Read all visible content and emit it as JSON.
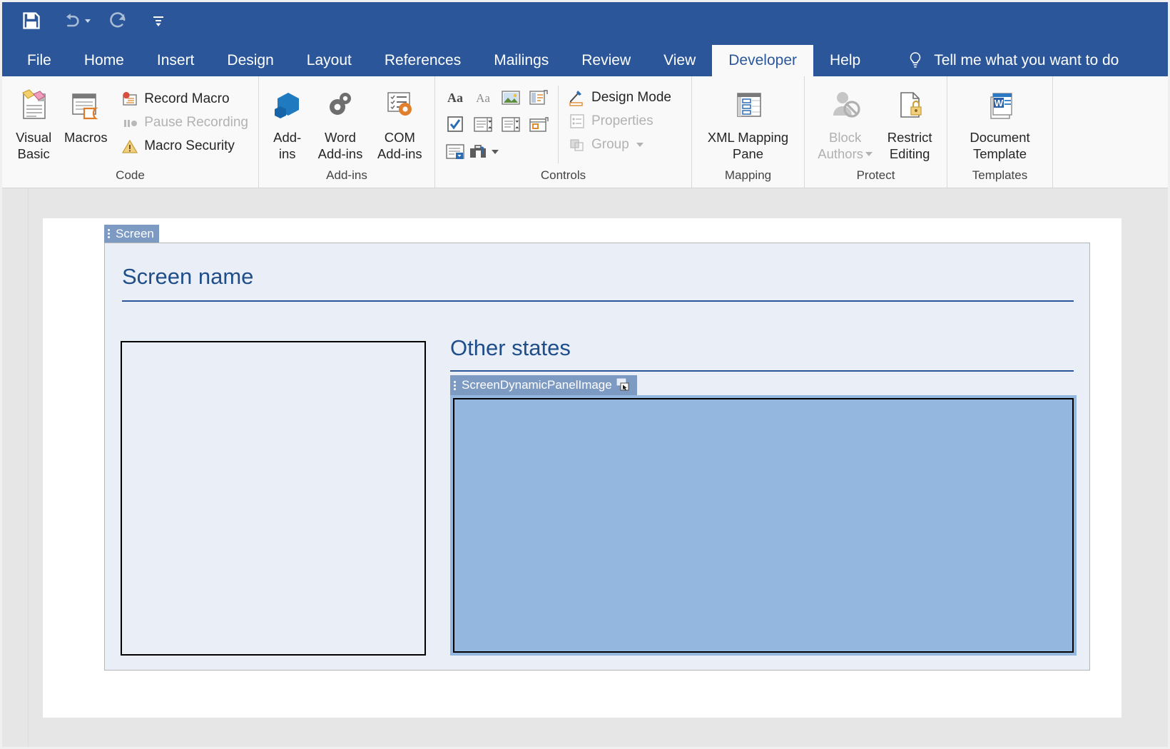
{
  "quick_access": {
    "items": [
      {
        "name": "save",
        "icon": "save-icon",
        "label": "Save",
        "enabled": true
      },
      {
        "name": "undo",
        "icon": "undo-icon",
        "label": "Undo",
        "enabled": false,
        "has_dropdown": true
      },
      {
        "name": "redo",
        "icon": "redo-icon",
        "label": "Redo",
        "enabled": false
      },
      {
        "name": "customize",
        "icon": "customize-quick-access-icon",
        "label": "Customize Quick Access Toolbar",
        "enabled": true
      }
    ]
  },
  "tabs": [
    {
      "label": "File",
      "active": false
    },
    {
      "label": "Home",
      "active": false
    },
    {
      "label": "Insert",
      "active": false
    },
    {
      "label": "Design",
      "active": false
    },
    {
      "label": "Layout",
      "active": false
    },
    {
      "label": "References",
      "active": false
    },
    {
      "label": "Mailings",
      "active": false
    },
    {
      "label": "Review",
      "active": false
    },
    {
      "label": "View",
      "active": false
    },
    {
      "label": "Developer",
      "active": true
    },
    {
      "label": "Help",
      "active": false
    }
  ],
  "tell_me": {
    "label": "Tell me what you want to do",
    "icon": "lightbulb-icon"
  },
  "ribbon": {
    "groups": [
      {
        "label": "Code",
        "big_buttons": [
          {
            "label": "Visual\nBasic",
            "line1": "Visual",
            "line2": "Basic",
            "icon": "visual-basic-icon",
            "enabled": true
          },
          {
            "label": "Macros",
            "line1": "Macros",
            "line2": "",
            "icon": "macros-icon",
            "enabled": true
          }
        ],
        "small_buttons": [
          {
            "label": "Record Macro",
            "icon": "record-macro-icon",
            "enabled": true
          },
          {
            "label": "Pause Recording",
            "icon": "pause-recording-icon",
            "enabled": false
          },
          {
            "label": "Macro Security",
            "icon": "macro-security-icon",
            "enabled": true
          }
        ]
      },
      {
        "label": "Add-ins",
        "big_buttons": [
          {
            "line1": "Add-",
            "line2": "ins",
            "icon": "add-ins-icon",
            "enabled": true
          },
          {
            "line1": "Word",
            "line2": "Add-ins",
            "icon": "word-add-ins-icon",
            "enabled": true
          },
          {
            "line1": "COM",
            "line2": "Add-ins",
            "icon": "com-add-ins-icon",
            "enabled": true
          }
        ],
        "small_buttons": []
      },
      {
        "label": "Controls",
        "control_icons": [
          "rich-text-content-control-icon",
          "plain-text-content-control-icon",
          "picture-content-control-icon",
          "building-block-gallery-content-control-icon",
          "check-box-content-control-icon",
          "combo-box-content-control-icon",
          "drop-down-list-content-control-icon",
          "date-picker-content-control-icon",
          "repeating-section-content-control-icon",
          "legacy-tools-icon"
        ],
        "small_buttons": [
          {
            "label": "Design Mode",
            "icon": "design-mode-icon",
            "enabled": true
          },
          {
            "label": "Properties",
            "icon": "properties-icon",
            "enabled": false
          },
          {
            "label": "Group",
            "icon": "group-icon",
            "enabled": false,
            "has_dropdown": true
          }
        ]
      },
      {
        "label": "Mapping",
        "big_buttons": [
          {
            "line1": "XML Mapping",
            "line2": "Pane",
            "icon": "xml-mapping-pane-icon",
            "enabled": true
          }
        ],
        "small_buttons": []
      },
      {
        "label": "Protect",
        "big_buttons": [
          {
            "line1": "Block",
            "line2": "Authors",
            "icon": "block-authors-icon",
            "enabled": false,
            "has_dropdown": true
          },
          {
            "line1": "Restrict",
            "line2": "Editing",
            "icon": "restrict-editing-icon",
            "enabled": true
          }
        ],
        "small_buttons": []
      },
      {
        "label": "Templates",
        "big_buttons": [
          {
            "line1": "Document",
            "line2": "Template",
            "icon": "document-template-icon",
            "enabled": true
          }
        ],
        "small_buttons": []
      }
    ]
  },
  "document": {
    "screen_tag": "Screen",
    "screen_title": "Screen name",
    "other_states_title": "Other states",
    "dynamic_panel_tag": "ScreenDynamicPanelImage",
    "dynamic_panel_tag_icon": "picture-content-control-icon",
    "left_placeholder_label": "",
    "colors": {
      "panel_fill": "#93b7de",
      "content_control_fill": "#e9eef7",
      "heading_color": "#1F4E89",
      "tag_fill": "#7d9ac2",
      "ribbon_accent": "#2B579A"
    }
  }
}
